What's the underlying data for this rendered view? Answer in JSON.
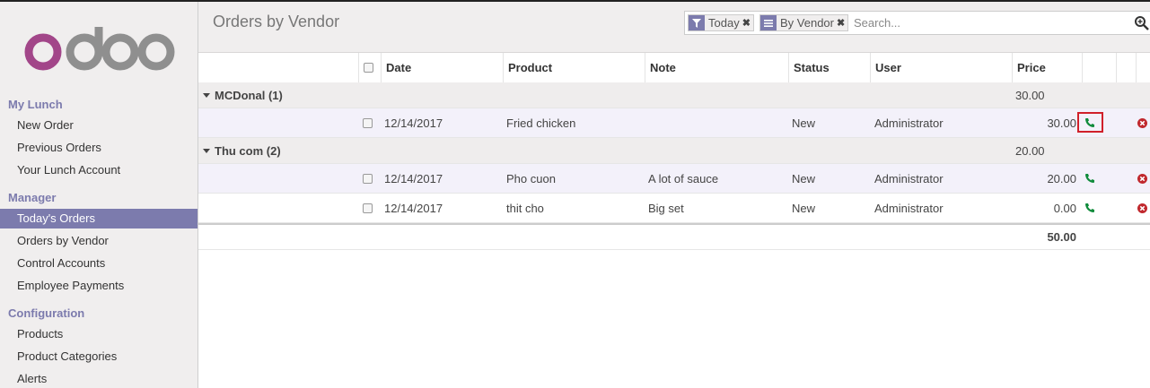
{
  "brand": {
    "logo_text": "odoo",
    "logo_color": "#a24689",
    "logo_gray": "#8f8f8f"
  },
  "sidebar": {
    "sections": [
      {
        "title": "My Lunch",
        "items": [
          "New Order",
          "Previous Orders",
          "Your Lunch Account"
        ]
      },
      {
        "title": "Manager",
        "items": [
          "Today's Orders",
          "Orders by Vendor",
          "Control Accounts",
          "Employee Payments"
        ]
      },
      {
        "title": "Configuration",
        "items": [
          "Products",
          "Product Categories",
          "Alerts"
        ]
      }
    ],
    "active_item": "Today's Orders",
    "accent": "#7c7bad"
  },
  "header": {
    "title": "Orders by Vendor",
    "search": {
      "facets": [
        {
          "icon": "filter-icon",
          "label": "Today"
        },
        {
          "icon": "group-by-icon",
          "label": "By Vendor"
        }
      ],
      "placeholder": "Search..."
    }
  },
  "table": {
    "columns": [
      "Date",
      "Product",
      "Note",
      "Status",
      "User",
      "Price"
    ],
    "groups": [
      {
        "label": "MCDonal (1)",
        "total": "30.00",
        "rows": [
          {
            "date": "12/14/2017",
            "product": "Fried chicken",
            "note": "",
            "status": "New",
            "user": "Administrator",
            "price": "30.00"
          }
        ]
      },
      {
        "label": "Thu com (2)",
        "total": "20.00",
        "rows": [
          {
            "date": "12/14/2017",
            "product": "Pho cuon",
            "note": "A lot of sauce",
            "status": "New",
            "user": "Administrator",
            "price": "20.00"
          },
          {
            "date": "12/14/2017",
            "product": "thit cho",
            "note": "Big set",
            "status": "New",
            "user": "Administrator",
            "price": "0.00"
          }
        ]
      }
    ],
    "grand_total": "50.00"
  }
}
